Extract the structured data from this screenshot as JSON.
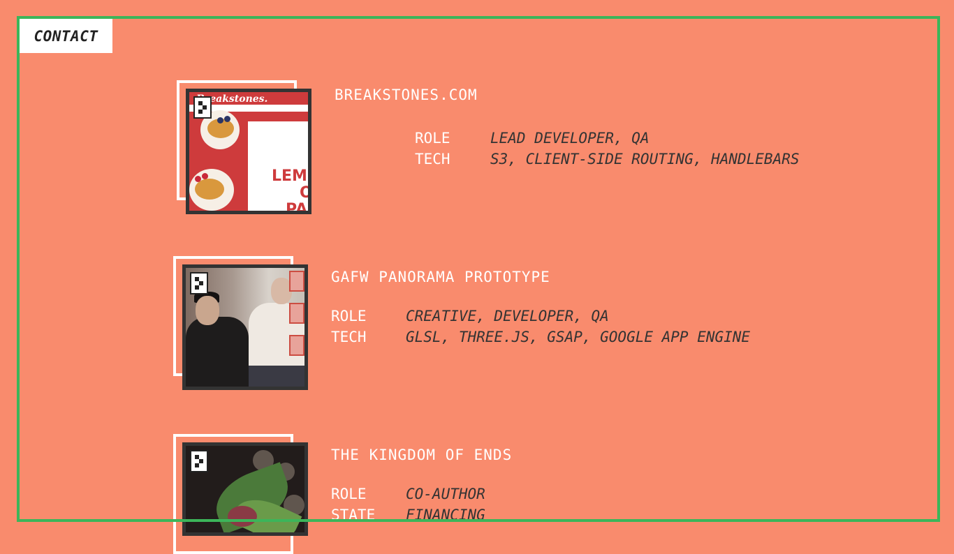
{
  "nav": {
    "contact_label": "CONTACT"
  },
  "colors": {
    "background": "#f98b6d",
    "frame": "#3cb55a",
    "thumb_border": "#333333",
    "thumb_back": "#ffffff"
  },
  "projects": [
    {
      "title": "BREAKSTONES.COM",
      "meta": [
        {
          "key": "ROLE",
          "value": "LEAD DEVELOPER, QA"
        },
        {
          "key": "TECH",
          "value": "S3, CLIENT-SIDE ROUTING, HANDLEBARS"
        }
      ],
      "image_text": {
        "logo": "Breakstones.",
        "big": [
          "LEM",
          "O",
          "PA"
        ]
      }
    },
    {
      "title": "GAFW PANORAMA PROTOTYPE",
      "meta": [
        {
          "key": "ROLE",
          "value": "CREATIVE, DEVELOPER, QA"
        },
        {
          "key": "TECH",
          "value": "GLSL, THREE.JS, GSAP, GOOGLE APP ENGINE"
        }
      ]
    },
    {
      "title": "THE KINGDOM OF ENDS",
      "meta": [
        {
          "key": "ROLE",
          "value": "CO-AUTHOR"
        },
        {
          "key": "STATE",
          "value": "FINANCING"
        }
      ]
    }
  ]
}
